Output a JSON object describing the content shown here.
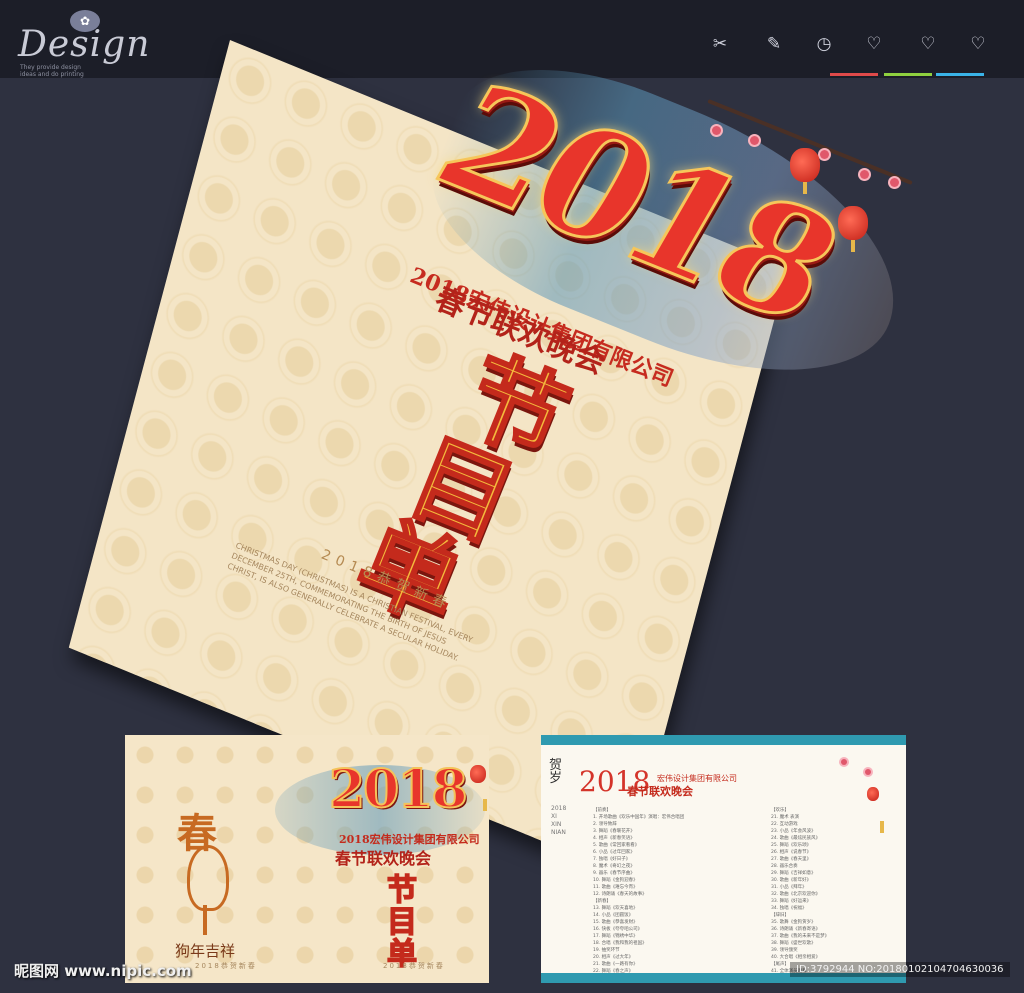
{
  "header": {
    "logo_word": "Design",
    "logo_tagline": "They provide design ideas and do printing",
    "tools": [
      {
        "icon": "scissors-icon",
        "glyph": "✂"
      },
      {
        "icon": "pencil-icon",
        "glyph": "✎"
      },
      {
        "icon": "clock-icon",
        "glyph": "◷"
      },
      {
        "icon": "heart-icon",
        "glyph": "♡"
      },
      {
        "icon": "heart-plus-icon",
        "glyph": "♡"
      },
      {
        "icon": "heart-minus-icon",
        "glyph": "♡"
      }
    ],
    "underline_colors": [
      "#e04a4a",
      "#8fd13f",
      "#3ab3e8"
    ]
  },
  "cover": {
    "year": "2018",
    "company": "2018宏伟设计集团有限公司",
    "event": "春节联欢晚会",
    "title_chars": [
      "节",
      "目",
      "单"
    ],
    "blessing": "2018恭贺新春",
    "english": "CHRISTMAS DAY (CHRISTMAS) IS A CHRISTIAN FESTIVAL, EVERY DECEMBER 25TH, COMMEMORATING THE BIRTH OF JESUS CHRIST, IS ALSO GENERALLY CELEBRATE A SECULAR HOLIDAY."
  },
  "preview_left": {
    "year": "2018",
    "company": "2018宏伟设计集团有限公司",
    "event": "春节联欢晚会",
    "title_chars": [
      "节",
      "目",
      "单"
    ],
    "chun": "春",
    "greeting": "狗年吉祥",
    "footer_left": "2018恭贺新春",
    "footer_right": "2018恭贺新春"
  },
  "preview_right": {
    "year": "2018",
    "company": "宏伟设计集团有限公司",
    "event": "春节联欢晚会",
    "side_chars": "贺岁",
    "side_sub": "2018 XI XIN NIAN",
    "col1": [
      "【前奏】",
      "1. 开场歌曲《欢乐中国年》演唱：宏伟合唱团",
      "2. 领导致辞",
      "3. 舞蹈《春暖花开》",
      "4. 相声《新春笑语》",
      "5. 歌曲《常回家看看》",
      "6. 小品《过年回家》",
      "7. 独唱《好日子》",
      "8. 魔术《奇幻之夜》",
      "9. 器乐《春节序曲》",
      "10. 舞蹈《金狗迎春》",
      "11. 歌曲《难忘今宵》",
      "12. 诗朗诵《春天的故事》",
      "【新春】",
      "13. 舞蹈《欢天喜地》",
      "14. 小品《团圆饭》",
      "15. 歌曲《恭喜发财》",
      "16. 快板《夸夸咱公司》",
      "17. 舞蹈《锦绣中华》",
      "18. 合唱《我和我的祖国》",
      "19. 抽奖环节",
      "20. 相声《过大年》",
      "21. 歌曲《一路有你》",
      "22. 舞蹈《春之声》",
      "23. 小品《年终总结》",
      "24. 歌曲《明天会更好》",
      "25. 舞蹈《花好月圆》",
      "26. 大合唱《难忘今宵》"
    ],
    "col2": [
      "【欢乐】",
      "21. 魔术 表演",
      "22. 互动游戏",
      "23. 小品《年会风波》",
      "24. 歌曲《最炫民族风》",
      "25. 舞蹈《欢乐颂》",
      "26. 相声《说春节》",
      "27. 歌曲《春天里》",
      "28. 器乐合奏",
      "29. 舞蹈《吉祥如意》",
      "30. 歌曲《新年好》",
      "31. 小品《拜年》",
      "32. 歌曲《北京欢迎你》",
      "33. 舞蹈《好运来》",
      "34. 独唱《祝福》",
      "【辞旧】",
      "35. 歌舞《金狗贺岁》",
      "36. 诗朗诵《新春寄语》",
      "37. 歌曲《我的未来不是梦》",
      "38. 舞蹈《盛世欢歌》",
      "39. 领导颁奖",
      "40. 大合唱《相亲相爱》",
      "【尾声】",
      "41. 全体演员谢幕",
      "42. 合影留念",
      "43. 歌曲《难忘今宵》",
      "44. 结束"
    ]
  },
  "watermark": {
    "left": "昵图网 www.nipic.com",
    "right": "ID:3792944 NO:20180102104704630036"
  }
}
